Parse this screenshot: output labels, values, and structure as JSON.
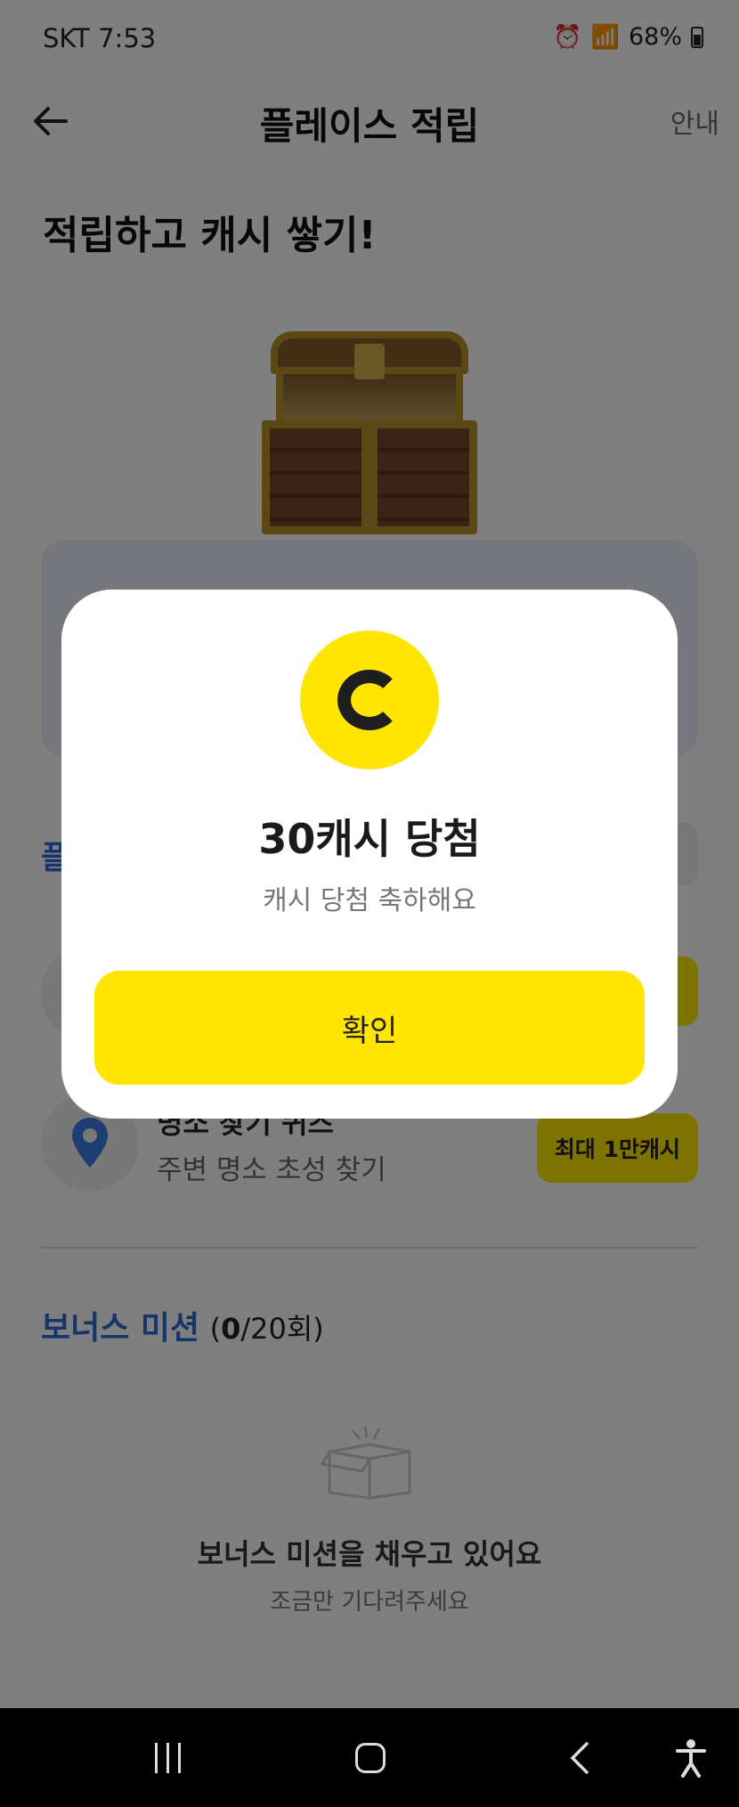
{
  "status_bar": {
    "carrier_time": "SKT 7:53",
    "battery": "68%"
  },
  "header": {
    "title": "플레이스 적립",
    "guide_label": "안내",
    "back_icon": "arrow-left-icon"
  },
  "main": {
    "headline": "적립하고 캐시 쌓기!",
    "section_label_partial": "플",
    "quiz": {
      "title": "명소 찾기 퀴즈",
      "subtitle": "주변 명소 초성 찾기",
      "badge": "최대 1만캐시"
    },
    "bonus": {
      "label": "보너스 미션",
      "count_open": "(",
      "count_current": "0",
      "count_rest": "/20회)"
    },
    "empty_state": {
      "title": "보너스 미션을 채우고 있어요",
      "subtitle": "조금만 기다려주세요"
    }
  },
  "modal": {
    "title": "30캐시 당첨",
    "subtitle": "캐시 당첨 축하해요",
    "confirm_label": "확인",
    "coin_color": "#ffe500"
  },
  "colors": {
    "accent_yellow": "#ffe600",
    "link_blue": "#2a6ad6"
  }
}
